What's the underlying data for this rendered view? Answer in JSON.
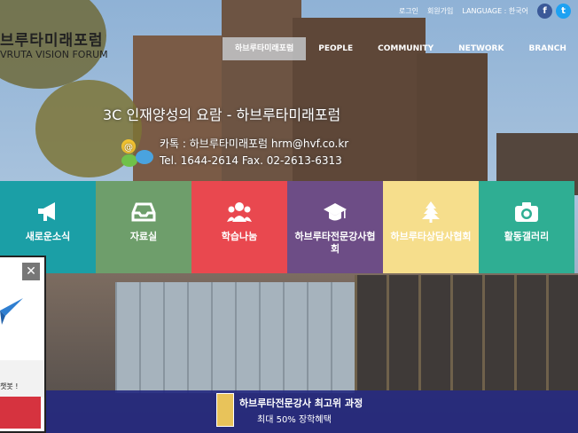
{
  "site": {
    "logo_ko": "브루타미래포럼",
    "logo_en": "VRUTA VISION FORUM"
  },
  "topbar": {
    "login": "로그인",
    "signup": "회원가입",
    "language": "LANGUAGE : 한국어",
    "facebook_glyph": "f",
    "twitter_glyph": "t"
  },
  "nav": {
    "items": [
      {
        "label": "하브루타미래포럼",
        "active": true
      },
      {
        "label": "PEOPLE"
      },
      {
        "label": "COMMUNITY"
      },
      {
        "label": "NETWORK"
      },
      {
        "label": "BRANCH"
      }
    ]
  },
  "hero": {
    "slogan": "3C 인재양성의 요람 - 하브루타미래포럼",
    "contact_line1": "카톡 : 하브루타미래포럼 hrm@hvf.co.kr",
    "contact_line2": "Tel. 1644-2614  Fax. 02-2613-6313"
  },
  "menu": {
    "tiles": [
      {
        "label": "새로운소식",
        "icon": "megaphone-icon",
        "color": "#1b9fa6"
      },
      {
        "label": "자료실",
        "icon": "inbox-icon",
        "color": "#6e9e6b"
      },
      {
        "label": "학습나눔",
        "icon": "group-icon",
        "color": "#e9484f"
      },
      {
        "label": "하브루타전문강사협회",
        "icon": "graduation-cap-icon",
        "color": "#6d4d86"
      },
      {
        "label": "하브루타상담사협회",
        "icon": "tree-icon",
        "color": "#f6de8c"
      },
      {
        "label": "활동갤러리",
        "icon": "camera-icon",
        "color": "#2fae93"
      }
    ]
  },
  "popup": {
    "close_glyph": "✕",
    "text": "챗봇 !"
  },
  "banner": {
    "line1": "하브루타전문강사 최고위 과정",
    "line2": "최대 50% 장학혜택"
  },
  "colors": {
    "nav_active_bg": "#d2d7dc",
    "banner_bg": "#242880",
    "popup_button": "#d6333f"
  }
}
